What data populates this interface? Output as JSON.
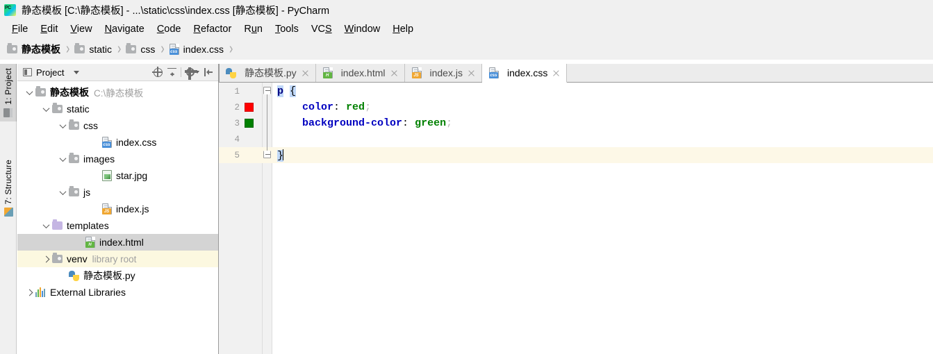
{
  "window": {
    "title": "静态模板 [C:\\静态模板] - ...\\static\\css\\index.css [静态模板] - PyCharm",
    "app_icon": "pycharm-logo-icon"
  },
  "menubar": {
    "items": [
      {
        "label": "File",
        "mnemonic": "F"
      },
      {
        "label": "Edit",
        "mnemonic": "E"
      },
      {
        "label": "View",
        "mnemonic": "V"
      },
      {
        "label": "Navigate",
        "mnemonic": "N"
      },
      {
        "label": "Code",
        "mnemonic": "C"
      },
      {
        "label": "Refactor",
        "mnemonic": "R"
      },
      {
        "label": "Run",
        "mnemonic": "u"
      },
      {
        "label": "Tools",
        "mnemonic": "T"
      },
      {
        "label": "VCS",
        "mnemonic": "S"
      },
      {
        "label": "Window",
        "mnemonic": "W"
      },
      {
        "label": "Help",
        "mnemonic": "H"
      }
    ]
  },
  "breadcrumb": {
    "items": [
      {
        "label": "静态模板",
        "icon": "folder-icon",
        "bold": true
      },
      {
        "label": "static",
        "icon": "folder-icon",
        "bold": false
      },
      {
        "label": "css",
        "icon": "folder-icon",
        "bold": false
      },
      {
        "label": "index.css",
        "icon": "css-file-icon",
        "bold": false
      }
    ],
    "separator": "›"
  },
  "toolstrip": {
    "buttons": [
      {
        "label": "1: Project",
        "icon": "project-window-icon",
        "active": true
      },
      {
        "label": "7: Structure",
        "icon": "structure-window-icon",
        "active": false
      }
    ]
  },
  "project_panel": {
    "header": {
      "title": "Project",
      "view_caret": "▾",
      "buttons": [
        {
          "name": "locate-in-tree-icon"
        },
        {
          "name": "collapse-all-icon"
        },
        {
          "name": "settings-gear-icon"
        },
        {
          "name": "hide-window-icon"
        }
      ]
    },
    "tree": [
      {
        "label": "静态模板",
        "extra": "C:\\静态模板",
        "icon": "folder-icon",
        "indent": 0,
        "twisty": "open",
        "bold": true,
        "state": "none"
      },
      {
        "label": "static",
        "extra": "",
        "icon": "folder-icon",
        "indent": 1,
        "twisty": "open",
        "bold": false,
        "state": "none"
      },
      {
        "label": "css",
        "extra": "",
        "icon": "folder-icon",
        "indent": 2,
        "twisty": "open",
        "bold": false,
        "state": "none"
      },
      {
        "label": "index.css",
        "extra": "",
        "icon": "css-file-icon",
        "indent": 4,
        "twisty": "none",
        "bold": false,
        "state": "none"
      },
      {
        "label": "images",
        "extra": "",
        "icon": "folder-icon",
        "indent": 2,
        "twisty": "open",
        "bold": false,
        "state": "none"
      },
      {
        "label": "star.jpg",
        "extra": "",
        "icon": "image-file-icon",
        "indent": 4,
        "twisty": "none",
        "bold": false,
        "state": "none"
      },
      {
        "label": "js",
        "extra": "",
        "icon": "folder-icon",
        "indent": 2,
        "twisty": "open",
        "bold": false,
        "state": "none"
      },
      {
        "label": "index.js",
        "extra": "",
        "icon": "js-file-icon",
        "indent": 4,
        "twisty": "none",
        "bold": false,
        "state": "none"
      },
      {
        "label": "templates",
        "extra": "",
        "icon": "folder-purple-icon",
        "indent": 1,
        "twisty": "open",
        "bold": false,
        "state": "none"
      },
      {
        "label": "index.html",
        "extra": "",
        "icon": "html-file-icon",
        "indent": 3,
        "twisty": "none",
        "bold": false,
        "state": "selected"
      },
      {
        "label": "venv",
        "extra": "library root",
        "icon": "folder-icon",
        "indent": 1,
        "twisty": "closed",
        "bold": false,
        "state": "highlight"
      },
      {
        "label": "静态模板.py",
        "extra": "",
        "icon": "python-file-icon",
        "indent": 2,
        "twisty": "none",
        "bold": false,
        "state": "none"
      },
      {
        "label": "External Libraries",
        "extra": "",
        "icon": "libraries-icon",
        "indent": 0,
        "twisty": "closed",
        "bold": false,
        "state": "none"
      }
    ]
  },
  "editor": {
    "tabs": [
      {
        "label": "静态模板.py",
        "icon": "python-file-icon",
        "active": false,
        "close": "×"
      },
      {
        "label": "index.html",
        "icon": "html-file-icon",
        "active": false,
        "close": "×"
      },
      {
        "label": "index.js",
        "icon": "js-file-icon",
        "active": false,
        "close": "×"
      },
      {
        "label": "index.css",
        "icon": "css-file-icon",
        "active": true,
        "close": "×"
      }
    ],
    "caret_line": 5,
    "gutter_swatches": [
      {
        "line": 2,
        "color": "#ff0000"
      },
      {
        "line": 3,
        "color": "#008000"
      }
    ],
    "lines": [
      {
        "number": "1",
        "tokens": [
          {
            "text": "p",
            "type": "selector",
            "highlight": true
          },
          {
            "text": " ",
            "type": "plain",
            "highlight": false
          },
          {
            "text": "{",
            "type": "punct",
            "highlight": true
          }
        ]
      },
      {
        "number": "2",
        "tokens": [
          {
            "text": "    ",
            "type": "plain",
            "highlight": false
          },
          {
            "text": "color",
            "type": "property",
            "highlight": false
          },
          {
            "text": ": ",
            "type": "punct",
            "highlight": false
          },
          {
            "text": "red",
            "type": "value",
            "highlight": false
          },
          {
            "text": ";",
            "type": "semi",
            "highlight": false
          }
        ]
      },
      {
        "number": "3",
        "tokens": [
          {
            "text": "    ",
            "type": "plain",
            "highlight": false
          },
          {
            "text": "background-color",
            "type": "property",
            "highlight": false
          },
          {
            "text": ": ",
            "type": "punct",
            "highlight": false
          },
          {
            "text": "green",
            "type": "value",
            "highlight": false
          },
          {
            "text": ";",
            "type": "semi",
            "highlight": false
          }
        ]
      },
      {
        "number": "4",
        "tokens": []
      },
      {
        "number": "5",
        "tokens": [
          {
            "text": "}",
            "type": "punct",
            "highlight": true
          }
        ]
      }
    ],
    "syntax_colors": {
      "selector": "#000080",
      "property": "#0000c0",
      "value": "#008000",
      "punctuation": "#000000",
      "semicolon": "#b8b8b8",
      "brace_match_bg": "#c0d8f8",
      "caret_line_bg": "#fdf8e7",
      "gutter_bg": "#f1f1f1",
      "line_number": "#999999"
    }
  }
}
